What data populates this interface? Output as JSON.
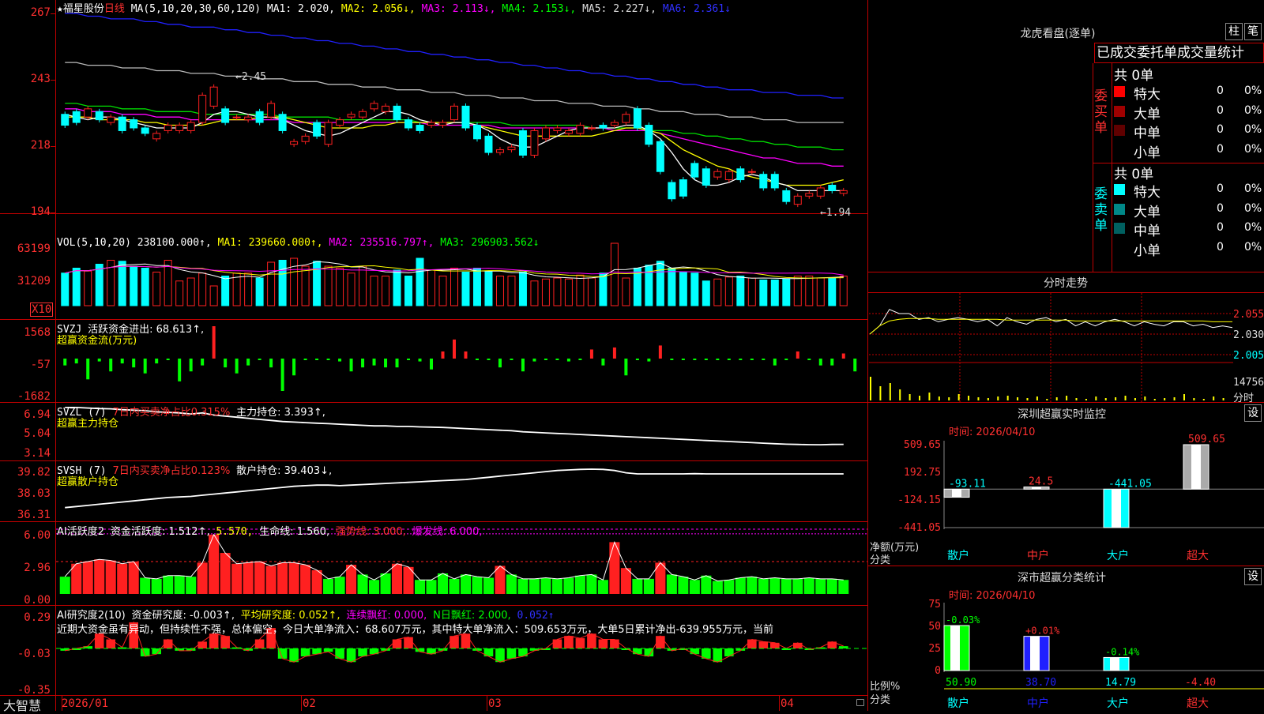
{
  "left": {
    "main_header": {
      "star": "★",
      "stock_name": "福星股份",
      "period": "日线",
      "ma_label": "MA(5,10,20,30,60,120)",
      "ma": [
        {
          "t": "MA1: 2.020,",
          "c": "#ffffff"
        },
        {
          "t": "MA2: 2.056↓,",
          "c": "#ffff00"
        },
        {
          "t": "MA3: 2.113↓,",
          "c": "#ff00ff"
        },
        {
          "t": "MA4: 2.153↓,",
          "c": "#00ff00"
        },
        {
          "t": "MA5: 2.227↓,",
          "c": "#dddddd"
        },
        {
          "t": "MA6: 2.361↓",
          "c": "#3030ff"
        }
      ],
      "hi_mark": "2.45",
      "lo_mark": "1.94"
    },
    "main_axis": [
      "267",
      "243",
      "218",
      "194"
    ],
    "vol_header": {
      "label": "VOL(5,10,20)",
      "value": "238100.000↑,",
      "ma1": "MA1: 239660.000↑,",
      "ma2": "MA2: 235516.797↑,",
      "ma3": "MA3: 296903.562↓"
    },
    "vol_axis": [
      "63199",
      "31209"
    ],
    "vol_unit": "X10",
    "svzj_header": {
      "label": "SVZJ",
      "text": "活跃资金进出: 68.613↑,",
      "sub": "超赢资金流(万元)"
    },
    "svzj_axis": [
      "1568",
      "-57",
      "-1682"
    ],
    "svzl_header": {
      "label": "SVZL (7)",
      "t1": "7日内买卖净占比0.315%",
      "t2": "主力持仓: 3.393↑,",
      "sub": "超赢主力持仓"
    },
    "svzl_axis": [
      "6.94",
      "5.04",
      "3.14"
    ],
    "svsh_header": {
      "label": "SVSH (7)",
      "t1": "7日内买卖净占比0.123%",
      "t2": "散户持仓: 39.403↓,",
      "sub": "超赢散户持仓"
    },
    "svsh_axis": [
      "39.82",
      "38.03",
      "36.31"
    ],
    "ai1_header": {
      "label": "AI活跃度2",
      "t1": "资金活跃度: 1.512↑,",
      "t2": "5.570,",
      "t3": "生命线: 1.560,",
      "t4": "强势线: 3.000,",
      "t5": "爆发线: 6.000,"
    },
    "ai1_axis": [
      "6.00",
      "2.96",
      "0.00"
    ],
    "ai2_header": {
      "label": "AI研究度2(10)",
      "t1": "资金研究度: -0.003↑,",
      "t2": "平均研究度: 0.052↑,",
      "t3": "连续飘红: 0.000,",
      "t4": "N日飘红: 2.000,",
      "t5": "0.052↑"
    },
    "ai2_axis": [
      "0.29",
      "-0.03",
      "-0.35"
    ],
    "comment": "近期大资金虽有异动，但持续性不强，总体偏空，今日大单净流入：68.607万元，其中特大单净流入：509.653万元，大单5日累计净出-639.955万元，当前",
    "date_axis": [
      "2026/01",
      "02",
      "03",
      "04"
    ],
    "logo": "大智慧"
  },
  "right": {
    "dragon_title": "龙虎看盘(逐单)",
    "btn_bar": "柱",
    "btn_pen": "笔",
    "tabs": [
      "已成交",
      "委托单",
      "成交量",
      "统计"
    ],
    "buy_label": "委买单",
    "sell_label": "委卖单",
    "buy_total": "共 0单",
    "sell_total": "共 0单",
    "buy_rows": [
      {
        "name": "特大",
        "n": "0",
        "p": "0%",
        "c": "#ff0000"
      },
      {
        "name": "大单",
        "n": "0",
        "p": "0%",
        "c": "#a00000"
      },
      {
        "name": "中单",
        "n": "0",
        "p": "0%",
        "c": "#600000"
      },
      {
        "name": "小单",
        "n": "0",
        "p": "0%",
        "c": ""
      }
    ],
    "sell_rows": [
      {
        "name": "特大",
        "n": "0",
        "p": "0%",
        "c": "#00ffff"
      },
      {
        "name": "大单",
        "n": "0",
        "p": "0%",
        "c": "#008888"
      },
      {
        "name": "中单",
        "n": "0",
        "p": "0%",
        "c": "#006060"
      },
      {
        "name": "小单",
        "n": "0",
        "p": "0%",
        "c": ""
      }
    ],
    "intraday_title": "分时走势",
    "intraday_axis": [
      "2.055",
      "2.030",
      "2.005"
    ],
    "intraday_vol": "14756",
    "intraday_vol_unit": "分时",
    "sz_title": "深圳超赢实时监控",
    "sz_btn": "设",
    "sz_time": "时间: 2026/04/10",
    "sz_axis": [
      "509.65",
      "192.75",
      "-124.15",
      "-441.05"
    ],
    "sz_ylabel": "净额(万元)",
    "sz_xlabel": "分类",
    "sz_values": [
      "-93.11",
      "24.5",
      "-441.05",
      "509.65"
    ],
    "sz_cats": [
      "散户",
      "中户",
      "大户",
      "超大"
    ],
    "cls_title": "深市超赢分类统计",
    "cls_btn": "设",
    "cls_time": "时间: 2026/04/10",
    "cls_axis": [
      "75",
      "50",
      "25",
      "0"
    ],
    "cls_ylabel": "比例%",
    "cls_xlabel": "分类",
    "cls_changes": [
      "-0.03%",
      "+0.01%",
      "-0.14%"
    ],
    "cls_values": [
      "50.90",
      "38.70",
      "14.79",
      "-4.40"
    ],
    "cls_cats": [
      "散户",
      "中户",
      "大户",
      "超大"
    ]
  },
  "colors": {
    "up": "#ff0000",
    "down": "#00ffff",
    "border": "#c00000",
    "inflow": "#ff0000",
    "outflow": "#00ff00"
  },
  "chart_data": {
    "type": "candlestick",
    "price_axis": [
      2.67,
      2.43,
      2.18,
      1.94
    ],
    "candles": [
      [
        2.3,
        2.26
      ],
      [
        2.31,
        2.27
      ],
      [
        2.29,
        2.32
      ],
      [
        2.31,
        2.28
      ],
      [
        2.27,
        2.29
      ],
      [
        2.29,
        2.24
      ],
      [
        2.28,
        2.25
      ],
      [
        2.25,
        2.23
      ],
      [
        2.21,
        2.23
      ],
      [
        2.24,
        2.26
      ],
      [
        2.24,
        2.26
      ],
      [
        2.24,
        2.27
      ],
      [
        2.27,
        2.37
      ],
      [
        2.33,
        2.4
      ],
      [
        2.32,
        2.27
      ],
      [
        2.29,
        2.29
      ],
      [
        2.28,
        2.29
      ],
      [
        2.31,
        2.27
      ],
      [
        2.29,
        2.34
      ],
      [
        2.3,
        2.24
      ],
      [
        2.19,
        2.2
      ],
      [
        2.2,
        2.22
      ],
      [
        2.27,
        2.22
      ],
      [
        2.19,
        2.27
      ],
      [
        2.26,
        2.28
      ],
      [
        2.29,
        2.3
      ],
      [
        2.29,
        2.31
      ],
      [
        2.32,
        2.34
      ],
      [
        2.31,
        2.33
      ],
      [
        2.33,
        2.28
      ],
      [
        2.28,
        2.25
      ],
      [
        2.26,
        2.24
      ],
      [
        2.26,
        2.27
      ],
      [
        2.26,
        2.27
      ],
      [
        2.28,
        2.33
      ],
      [
        2.33,
        2.25
      ],
      [
        2.26,
        2.21
      ],
      [
        2.22,
        2.16
      ],
      [
        2.16,
        2.17
      ],
      [
        2.17,
        2.18
      ],
      [
        2.24,
        2.15
      ],
      [
        2.15,
        2.24
      ],
      [
        2.21,
        2.25
      ],
      [
        2.24,
        2.25
      ],
      [
        2.23,
        2.24
      ],
      [
        2.23,
        2.26
      ],
      [
        2.25,
        2.25
      ],
      [
        2.26,
        2.25
      ],
      [
        2.26,
        2.27
      ],
      [
        2.27,
        2.3
      ],
      [
        2.32,
        2.25
      ],
      [
        2.26,
        2.19
      ],
      [
        2.2,
        2.09
      ],
      [
        2.05,
        1.99
      ],
      [
        2.06,
        2.0
      ],
      [
        2.12,
        2.07
      ],
      [
        2.1,
        2.04
      ],
      [
        2.07,
        2.09
      ],
      [
        2.06,
        2.09
      ],
      [
        2.1,
        2.06
      ],
      [
        2.09,
        2.09
      ],
      [
        2.08,
        2.03
      ],
      [
        2.08,
        2.03
      ],
      [
        2.02,
        1.98
      ],
      [
        1.97,
        2.0
      ],
      [
        2.0,
        2.01
      ],
      [
        2.0,
        2.03
      ],
      [
        2.04,
        2.02
      ],
      [
        2.01,
        2.02
      ]
    ],
    "ma5": [
      2.3,
      2.29,
      2.28,
      2.29,
      2.29,
      2.28,
      2.27,
      2.26,
      2.25,
      2.25,
      2.25,
      2.25,
      2.27,
      2.3,
      2.31,
      2.31,
      2.3,
      2.29,
      2.29,
      2.28,
      2.26,
      2.24,
      2.23,
      2.22,
      2.23,
      2.25,
      2.27,
      2.29,
      2.31,
      2.31,
      2.3,
      2.28,
      2.27,
      2.26,
      2.27,
      2.27,
      2.26,
      2.24,
      2.21,
      2.19,
      2.18,
      2.18,
      2.2,
      2.22,
      2.24,
      2.25,
      2.25,
      2.25,
      2.25,
      2.26,
      2.26,
      2.24,
      2.21,
      2.16,
      2.1,
      2.06,
      2.04,
      2.04,
      2.05,
      2.07,
      2.08,
      2.07,
      2.05,
      2.04,
      2.02,
      2.02,
      2.02,
      2.02,
      2.02
    ],
    "ma10": [
      2.29,
      2.29,
      2.29,
      2.28,
      2.28,
      2.28,
      2.28,
      2.27,
      2.27,
      2.26,
      2.26,
      2.26,
      2.26,
      2.27,
      2.28,
      2.28,
      2.28,
      2.29,
      2.29,
      2.29,
      2.28,
      2.27,
      2.26,
      2.25,
      2.25,
      2.25,
      2.25,
      2.26,
      2.26,
      2.27,
      2.27,
      2.27,
      2.27,
      2.27,
      2.27,
      2.27,
      2.26,
      2.25,
      2.24,
      2.23,
      2.22,
      2.22,
      2.22,
      2.22,
      2.22,
      2.22,
      2.22,
      2.23,
      2.24,
      2.25,
      2.25,
      2.24,
      2.23,
      2.2,
      2.17,
      2.15,
      2.13,
      2.11,
      2.1,
      2.08,
      2.07,
      2.06,
      2.05,
      2.04,
      2.04,
      2.04,
      2.04,
      2.05,
      2.06
    ],
    "ma20": [
      2.32,
      2.32,
      2.31,
      2.31,
      2.31,
      2.3,
      2.3,
      2.3,
      2.29,
      2.29,
      2.29,
      2.28,
      2.28,
      2.28,
      2.28,
      2.28,
      2.28,
      2.28,
      2.28,
      2.28,
      2.27,
      2.27,
      2.27,
      2.27,
      2.27,
      2.27,
      2.27,
      2.27,
      2.27,
      2.27,
      2.27,
      2.27,
      2.26,
      2.26,
      2.26,
      2.26,
      2.26,
      2.26,
      2.25,
      2.25,
      2.25,
      2.25,
      2.25,
      2.25,
      2.25,
      2.25,
      2.25,
      2.25,
      2.24,
      2.24,
      2.24,
      2.24,
      2.23,
      2.22,
      2.21,
      2.2,
      2.19,
      2.18,
      2.17,
      2.16,
      2.15,
      2.14,
      2.14,
      2.13,
      2.12,
      2.12,
      2.12,
      2.11,
      2.11
    ],
    "ma30": [
      2.34,
      2.34,
      2.33,
      2.33,
      2.33,
      2.32,
      2.32,
      2.32,
      2.31,
      2.31,
      2.31,
      2.31,
      2.3,
      2.3,
      2.3,
      2.3,
      2.3,
      2.3,
      2.3,
      2.29,
      2.29,
      2.29,
      2.29,
      2.29,
      2.28,
      2.28,
      2.28,
      2.28,
      2.28,
      2.28,
      2.28,
      2.27,
      2.27,
      2.27,
      2.27,
      2.27,
      2.27,
      2.27,
      2.27,
      2.26,
      2.26,
      2.26,
      2.26,
      2.26,
      2.26,
      2.26,
      2.25,
      2.25,
      2.25,
      2.25,
      2.25,
      2.24,
      2.24,
      2.24,
      2.23,
      2.23,
      2.22,
      2.22,
      2.21,
      2.21,
      2.2,
      2.2,
      2.19,
      2.19,
      2.18,
      2.18,
      2.18,
      2.17,
      2.17
    ],
    "ma60": [
      2.49,
      2.49,
      2.48,
      2.48,
      2.48,
      2.47,
      2.47,
      2.47,
      2.46,
      2.46,
      2.46,
      2.45,
      2.45,
      2.45,
      2.44,
      2.44,
      2.44,
      2.43,
      2.43,
      2.43,
      2.42,
      2.42,
      2.42,
      2.41,
      2.41,
      2.41,
      2.4,
      2.4,
      2.4,
      2.39,
      2.39,
      2.39,
      2.38,
      2.38,
      2.38,
      2.37,
      2.37,
      2.37,
      2.36,
      2.36,
      2.36,
      2.35,
      2.35,
      2.35,
      2.34,
      2.34,
      2.34,
      2.33,
      2.33,
      2.33,
      2.32,
      2.32,
      2.31,
      2.31,
      2.31,
      2.3,
      2.3,
      2.3,
      2.29,
      2.29,
      2.29,
      2.28,
      2.28,
      2.28,
      2.27,
      2.27,
      2.27,
      2.27,
      2.27
    ],
    "ma120": [
      2.67,
      2.67,
      2.66,
      2.66,
      2.65,
      2.65,
      2.65,
      2.64,
      2.64,
      2.63,
      2.63,
      2.62,
      2.62,
      2.62,
      2.61,
      2.61,
      2.6,
      2.6,
      2.59,
      2.59,
      2.58,
      2.58,
      2.57,
      2.57,
      2.56,
      2.56,
      2.55,
      2.55,
      2.54,
      2.54,
      2.53,
      2.53,
      2.52,
      2.52,
      2.51,
      2.51,
      2.5,
      2.5,
      2.49,
      2.49,
      2.48,
      2.48,
      2.47,
      2.47,
      2.46,
      2.46,
      2.45,
      2.45,
      2.44,
      2.44,
      2.43,
      2.43,
      2.42,
      2.42,
      2.41,
      2.41,
      2.4,
      2.4,
      2.39,
      2.39,
      2.39,
      2.38,
      2.38,
      2.38,
      2.37,
      2.37,
      2.37,
      2.36,
      2.36
    ],
    "volume_x10": [
      33000,
      38000,
      35000,
      42000,
      46000,
      45000,
      40000,
      38000,
      34000,
      46000,
      25000,
      28000,
      33000,
      20000,
      30000,
      33000,
      33000,
      28000,
      44000,
      46000,
      48000,
      40000,
      45000,
      40000,
      38000,
      33000,
      40000,
      30000,
      30000,
      36000,
      30000,
      48000,
      36000,
      30000,
      38000,
      34000,
      38000,
      35000,
      30000,
      30000,
      34000,
      25000,
      27000,
      28000,
      27000,
      31000,
      28000,
      33000,
      63199,
      28000,
      38000,
      41000,
      45000,
      38000,
      34000,
      33000,
      25000,
      27000,
      29000,
      30000,
      28000,
      26000,
      26000,
      27000,
      30000,
      30000,
      28000,
      28000,
      30000
    ],
    "svzj": [
      -400,
      -300,
      -1100,
      -200,
      -700,
      -300,
      -500,
      -800,
      -300,
      -100,
      -1200,
      -700,
      -400,
      1568,
      -500,
      -800,
      -400,
      -100,
      -500,
      -1682,
      -900,
      -100,
      -100,
      -100,
      -200,
      -700,
      -500,
      -400,
      -500,
      -500,
      -100,
      -200,
      -600,
      300,
      900,
      300,
      -100,
      -100,
      -500,
      -100,
      -700,
      -200,
      -100,
      -100,
      -200,
      -100,
      400,
      -400,
      500,
      -900,
      -100,
      -200,
      600,
      -100,
      -100,
      -100,
      -100,
      -100,
      -100,
      -100,
      -100,
      -100,
      -400,
      -100,
      300,
      -100,
      -400,
      -400,
      200,
      -700
    ],
    "svzl": [
      6.8,
      6.8,
      6.75,
      6.7,
      6.68,
      6.6,
      6.55,
      6.5,
      6.4,
      6.35,
      6.3,
      6.2,
      6.3,
      6.1,
      6.0,
      5.9,
      5.8,
      5.7,
      5.6,
      5.5,
      5.45,
      5.4,
      5.35,
      5.3,
      5.25,
      5.2,
      5.15,
      5.1,
      5.1,
      5.05,
      5.05,
      5.0,
      4.98,
      4.95,
      4.9,
      4.85,
      4.8,
      4.75,
      4.7,
      4.65,
      4.55,
      4.5,
      4.45,
      4.4,
      4.35,
      4.3,
      4.25,
      4.2,
      4.15,
      4.1,
      4.05,
      4.0,
      3.95,
      3.9,
      3.85,
      3.8,
      3.75,
      3.7,
      3.65,
      3.6,
      3.55,
      3.5,
      3.45,
      3.4,
      3.38,
      3.36,
      3.35,
      3.38,
      3.39
    ],
    "svsh": [
      36.4,
      36.5,
      36.6,
      36.7,
      36.8,
      36.9,
      37.0,
      37.1,
      37.2,
      37.3,
      37.35,
      37.4,
      37.5,
      37.6,
      37.7,
      37.8,
      37.9,
      38.0,
      38.1,
      38.2,
      38.3,
      38.35,
      38.4,
      38.4,
      38.35,
      38.4,
      38.45,
      38.5,
      38.55,
      38.6,
      38.65,
      38.7,
      38.75,
      38.8,
      38.85,
      38.9,
      39.0,
      39.1,
      39.2,
      39.3,
      39.4,
      39.5,
      39.6,
      39.7,
      39.75,
      39.8,
      39.82,
      39.8,
      39.7,
      39.5,
      39.4,
      39.4,
      39.4,
      39.4,
      39.4,
      39.42,
      39.4,
      39.4,
      39.4,
      39.4,
      39.4,
      39.4,
      39.4,
      39.4,
      39.4,
      39.4,
      39.4,
      39.4,
      39.4
    ],
    "ai_activity": [
      1.6,
      2.8,
      3.0,
      3.2,
      3.1,
      2.8,
      3.0,
      1.5,
      1.4,
      1.7,
      1.7,
      1.6,
      2.9,
      5.5,
      3.8,
      2.8,
      2.9,
      3.0,
      2.6,
      2.9,
      2.9,
      2.7,
      2.2,
      1.4,
      1.6,
      2.7,
      1.8,
      1.3,
      1.9,
      2.8,
      2.5,
      1.3,
      1.3,
      1.9,
      1.4,
      1.8,
      1.6,
      1.5,
      2.6,
      1.8,
      1.4,
      1.4,
      1.5,
      1.4,
      1.5,
      1.7,
      1.8,
      1.3,
      4.8,
      2.4,
      1.4,
      1.4,
      2.9,
      1.8,
      1.6,
      1.3,
      1.7,
      1.2,
      1.3,
      1.5,
      1.6,
      1.4,
      1.5,
      1.4,
      1.4,
      1.5,
      1.4,
      1.4,
      1.3
    ],
    "ai_research": [
      -0.05,
      -0.03,
      -0.01,
      0.1,
      0.05,
      -0.02,
      0.2,
      -0.1,
      -0.08,
      0.05,
      -0.05,
      -0.05,
      0.03,
      0.1,
      0.08,
      -0.02,
      -0.05,
      0.05,
      0.15,
      -0.12,
      -0.15,
      -0.1,
      -0.08,
      -0.06,
      -0.12,
      -0.15,
      -0.1,
      -0.08,
      -0.05,
      0.05,
      0.07,
      -0.06,
      -0.08,
      -0.05,
      0.08,
      0.1,
      -0.05,
      -0.1,
      -0.15,
      -0.12,
      -0.1,
      -0.05,
      -0.03,
      0.05,
      0.08,
      0.06,
      0.1,
      0.05,
      0.05,
      -0.03,
      -0.08,
      -0.1,
      0.08,
      -0.05,
      -0.03,
      -0.08,
      -0.12,
      -0.15,
      -0.1,
      -0.05,
      0.05,
      0.03,
      0.02,
      -0.03,
      0.02,
      -0.04,
      -0.02,
      0.03,
      -0.01
    ],
    "intraday_price": [
      2.03,
      2.04,
      2.06,
      2.055,
      2.055,
      2.048,
      2.05,
      2.045,
      2.048,
      2.05,
      2.048,
      2.045,
      2.048,
      2.04,
      2.05,
      2.045,
      2.042,
      2.048,
      2.05,
      2.045,
      2.048,
      2.04,
      2.045,
      2.04,
      2.045,
      2.048,
      2.045,
      2.04,
      2.045,
      2.042,
      2.04,
      2.045,
      2.045,
      2.04,
      2.042,
      2.038,
      2.04,
      2.038
    ],
    "intraday_avg": [
      2.03,
      2.04,
      2.046,
      2.048,
      2.049,
      2.049,
      2.049,
      2.048,
      2.048,
      2.048,
      2.048,
      2.048,
      2.048,
      2.048,
      2.047,
      2.047,
      2.047,
      2.047,
      2.047,
      2.047,
      2.047,
      2.046,
      2.046,
      2.046,
      2.046,
      2.046,
      2.046,
      2.046,
      2.046,
      2.046,
      2.046,
      2.046,
      2.046,
      2.046,
      2.046,
      2.045,
      2.045,
      2.045
    ],
    "intraday_axis": [
      2.055,
      2.03,
      2.005
    ],
    "sz_monitor": {
      "type": "bar",
      "categories": [
        "散户",
        "中户",
        "大户",
        "超大"
      ],
      "values": [
        -93.11,
        24.5,
        -441.05,
        509.65
      ],
      "ylim": [
        -441.05,
        509.65
      ]
    },
    "sz_class": {
      "type": "bar",
      "categories": [
        "散户",
        "中户",
        "大户",
        "超大"
      ],
      "values": [
        50.9,
        38.7,
        14.79,
        -4.4
      ],
      "changes": [
        "-0.03%",
        "+0.01%",
        "-0.14%"
      ],
      "ylim": [
        0,
        75
      ]
    }
  }
}
